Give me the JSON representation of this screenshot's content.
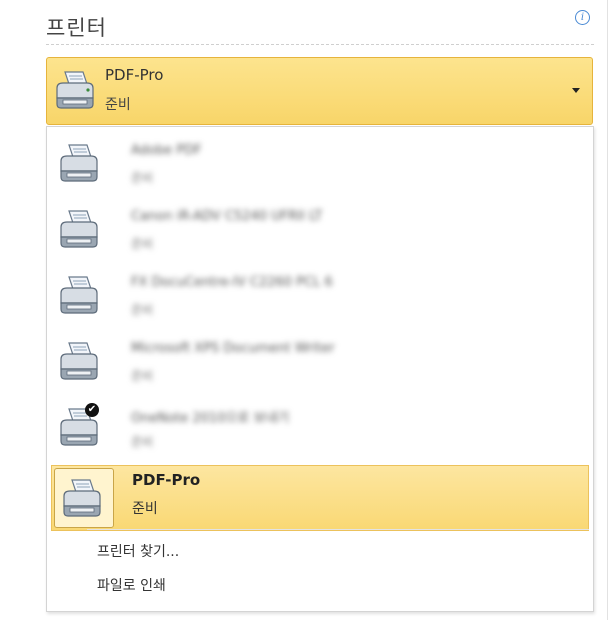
{
  "header": {
    "title": "프린터",
    "info_icon": "info-icon",
    "info_symbol": "i"
  },
  "selected_printer": {
    "name": "PDF-Pro",
    "status": "준비"
  },
  "printers": [
    {
      "name": "Adobe PDF",
      "status": "준비",
      "blurred": true
    },
    {
      "name": "Canon iR-ADV C5240 UFRII LT",
      "status": "준비",
      "blurred": true
    },
    {
      "name": "FX DocuCentre-IV C2260 PCL 6",
      "status": "준비",
      "blurred": true
    },
    {
      "name": "Microsoft XPS Document Writer",
      "status": "준비",
      "blurred": true
    },
    {
      "name": "OneNote 2010으로 보내기",
      "status": "준비",
      "blurred": true,
      "default_badge": "✔"
    },
    {
      "name": "PDF-Pro",
      "status": "준비",
      "selected": true
    }
  ],
  "menu": {
    "find_printer": "프린터 찾기...",
    "print_to_file": "파일로 인쇄"
  },
  "colors": {
    "highlight_top": "#fde48e",
    "highlight_bottom": "#f8d569",
    "highlight_border": "#e6b43c"
  }
}
